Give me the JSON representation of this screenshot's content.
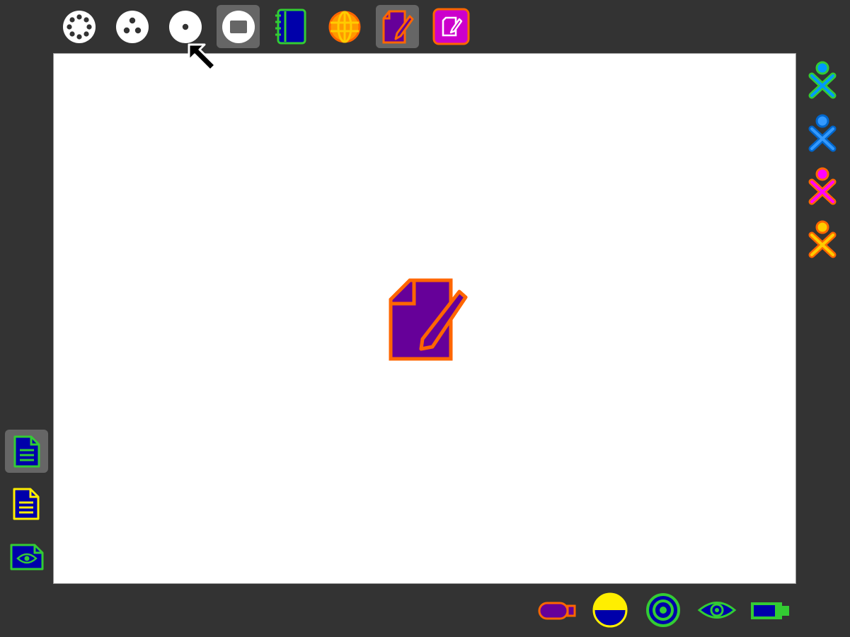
{
  "theme": {
    "frame_background": "#333333",
    "canvas_background": "#ffffff",
    "highlight": "#666666"
  },
  "top_toolbar": {
    "items": [
      {
        "id": "zoom-neighborhood",
        "icon": "neighborhood-view-icon",
        "active": false
      },
      {
        "id": "zoom-group",
        "icon": "group-view-icon",
        "active": false
      },
      {
        "id": "zoom-home",
        "icon": "home-view-icon",
        "active": false
      },
      {
        "id": "zoom-activity",
        "icon": "activity-view-icon",
        "active": true
      },
      {
        "id": "journal",
        "icon": "journal-icon",
        "active": false
      },
      {
        "id": "browse",
        "icon": "browse-globe-icon",
        "active": false
      },
      {
        "id": "write",
        "icon": "write-activity-icon",
        "active": true
      },
      {
        "id": "write-shared",
        "icon": "write-shared-activity-icon",
        "active": false
      }
    ]
  },
  "canvas": {
    "center_icon": "write-activity-icon"
  },
  "right_bar": {
    "buddies": [
      {
        "icon": "buddy-xo-icon",
        "stroke": "#33cc33",
        "fill": "#0099ff"
      },
      {
        "icon": "buddy-xo-icon",
        "stroke": "#0066cc",
        "fill": "#3399ff"
      },
      {
        "icon": "buddy-xo-icon",
        "stroke": "#ff6600",
        "fill": "#ff00ff"
      },
      {
        "icon": "buddy-xo-icon",
        "stroke": "#ff6600",
        "fill": "#ffcc00"
      }
    ]
  },
  "left_bar": {
    "items": [
      {
        "icon": "document-green-icon",
        "active": true
      },
      {
        "icon": "document-yellow-icon",
        "active": false
      },
      {
        "icon": "document-preview-eye-icon",
        "active": false
      }
    ]
  },
  "bottom_tray": {
    "items": [
      {
        "icon": "usb-drive-icon"
      },
      {
        "icon": "brightness-display-icon"
      },
      {
        "icon": "wireless-network-icon"
      },
      {
        "icon": "accessibility-eye-icon"
      },
      {
        "icon": "battery-icon"
      }
    ]
  },
  "cursor": {
    "icon": "pointer-arrow-icon"
  }
}
